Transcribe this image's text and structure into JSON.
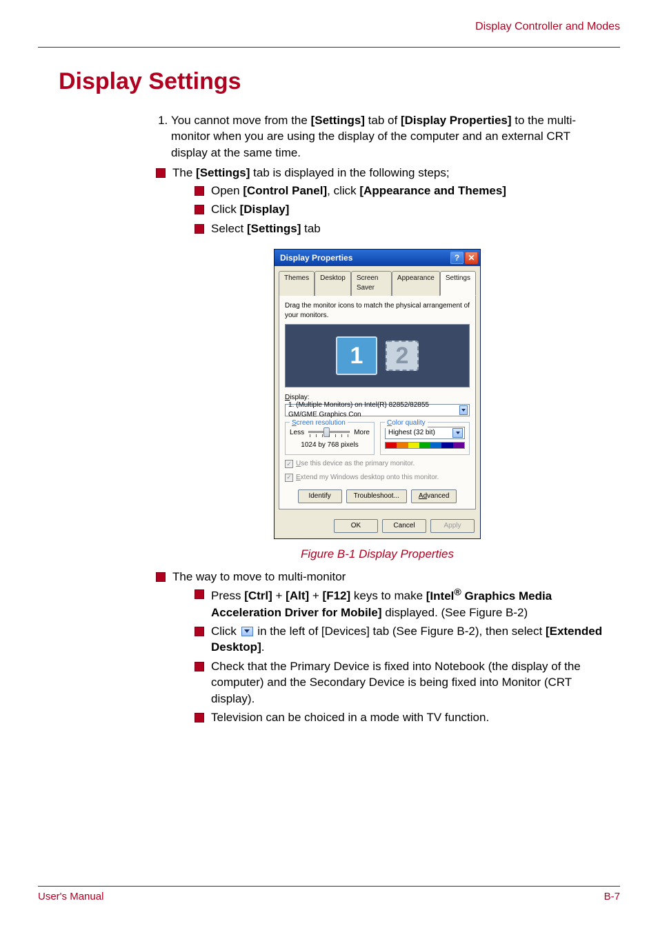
{
  "header": {
    "section_title": "Display Controller and Modes"
  },
  "heading": "Display Settings",
  "list": {
    "item1_pre": "You cannot move from the ",
    "item1_b1": "[Settings]",
    "item1_mid": " tab of ",
    "item1_b2": "[Display Properties]",
    "item1_post": " to the multi-monitor when you are using the display of the computer and an external CRT display at the same time.",
    "sq1_pre": "The ",
    "sq1_b": "[Settings]",
    "sq1_post": " tab is displayed in the following steps;",
    "sq1a_pre": "Open ",
    "sq1a_b1": "[Control Panel]",
    "sq1a_mid": ", click ",
    "sq1a_b2": "[Appearance and Themes]",
    "sq1b_pre": "Click ",
    "sq1b_b": "[Display]",
    "sq1c_pre": "Select ",
    "sq1c_b": "[Settings]",
    "sq1c_post": " tab",
    "sq2": "The way to move to multi-monitor",
    "sq2a_pre": "Press ",
    "sq2a_b1": "[Ctrl]",
    "sq2a_plus": " + ",
    "sq2a_b2": "[Alt]",
    "sq2a_b3": "[F12]",
    "sq2a_mid": " keys to make ",
    "sq2a_b4a": "[Intel",
    "sq2a_reg": "®",
    "sq2a_b4b": " Graphics Media Acceleration Driver for Mobile]",
    "sq2a_post": " displayed. (See Figure B-2)",
    "sq2b_pre": "Click ",
    "sq2b_mid": " in the left of [Devices] tab (See Figure B-2), then select ",
    "sq2b_b": "[Extended Desktop]",
    "sq2b_post": ".",
    "sq2c": "Check that the Primary Device is fixed into Notebook (the display of the computer) and the Secondary Device is being fixed into Monitor (CRT display).",
    "sq2d": "Television can be choiced in a mode with TV function."
  },
  "figure_caption": "Figure B-1 Display Properties",
  "dialog": {
    "title": "Display Properties",
    "tabs": {
      "themes": "Themes",
      "desktop": "Desktop",
      "screensaver": "Screen Saver",
      "appearance": "Appearance",
      "settings": "Settings"
    },
    "instruction": "Drag the monitor icons to match the physical arrangement of your monitors.",
    "monitor1": "1",
    "monitor2": "2",
    "display_label": "Display:",
    "display_value": "1. (Multiple Monitors) on Intel(R) 82852/82855 GM/GME Graphics Con",
    "screen_res_legend": "Screen resolution",
    "less": "Less",
    "more": "More",
    "resolution_value": "1024 by 768 pixels",
    "color_legend": "Color quality",
    "color_value": "Highest (32 bit)",
    "chk1": "Use this device as the primary monitor.",
    "chk2": "Extend my Windows desktop onto this monitor.",
    "btn_identify": "Identify",
    "btn_troubleshoot": "Troubleshoot...",
    "btn_advanced": "Advanced",
    "btn_ok": "OK",
    "btn_cancel": "Cancel",
    "btn_apply": "Apply"
  },
  "footer": {
    "left": "User's Manual",
    "right": "B-7"
  }
}
